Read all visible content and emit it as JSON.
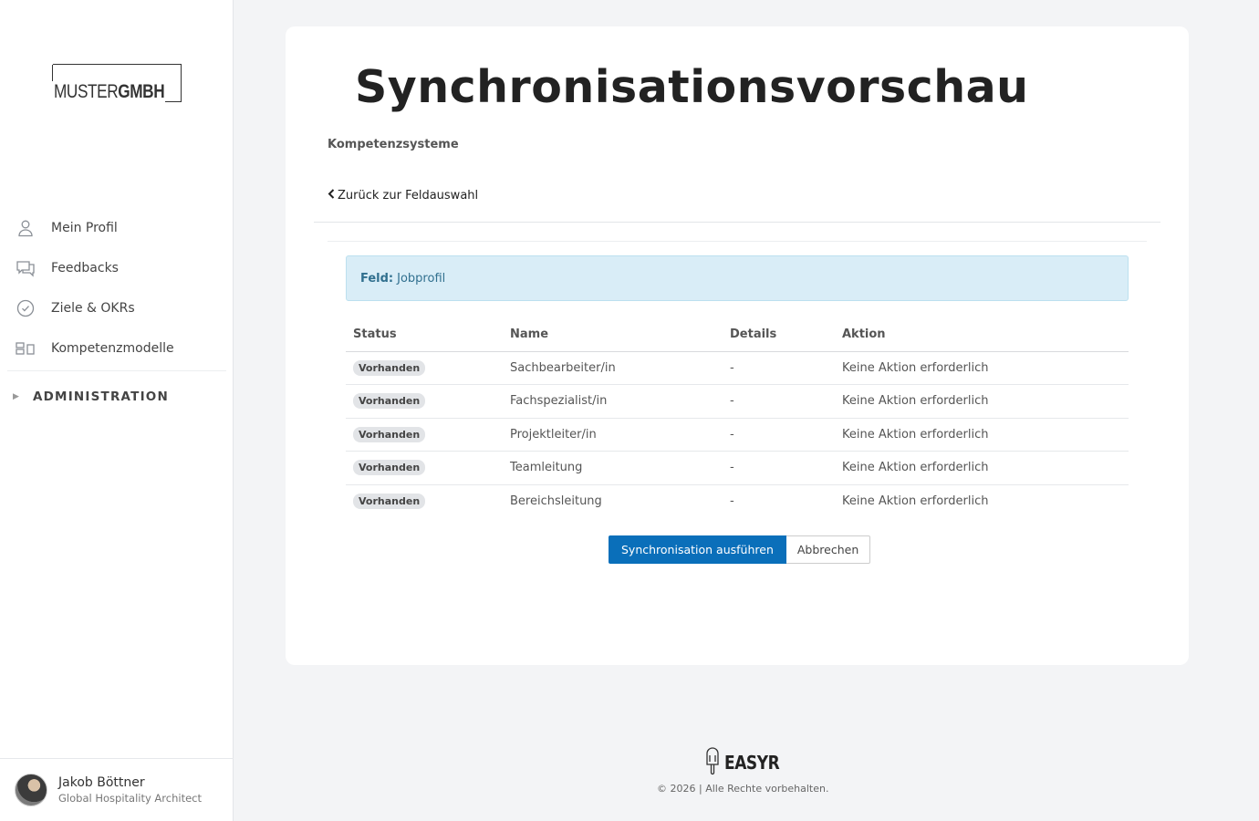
{
  "brand": {
    "logo_light": "MUSTER",
    "logo_bold": "GMBH"
  },
  "nav": {
    "items": [
      {
        "label": "Mein Profil",
        "icon": "user-icon"
      },
      {
        "label": "Feedbacks",
        "icon": "chat-bubbles-icon"
      },
      {
        "label": "Ziele & OKRs",
        "icon": "check-circle-icon"
      },
      {
        "label": "Kompetenzmodelle",
        "icon": "blocks-icon"
      }
    ],
    "admin_label": "ADMINISTRATION"
  },
  "user": {
    "name": "Jakob Böttner",
    "role": "Global Hospitality Architect"
  },
  "page": {
    "title": "Synchronisationsvorschau",
    "subtitle": "Kompetenzsysteme",
    "back_label": "Zurück zur Feldauswahl"
  },
  "alert": {
    "key": "Feld:",
    "value": "Jobprofil"
  },
  "table": {
    "headers": [
      "Status",
      "Name",
      "Details",
      "Aktion"
    ],
    "rows": [
      {
        "status": "Vorhanden",
        "name": "Sachbearbeiter/in",
        "details": "-",
        "action": "Keine Aktion erforderlich"
      },
      {
        "status": "Vorhanden",
        "name": "Fachspezialist/in",
        "details": "-",
        "action": "Keine Aktion erforderlich"
      },
      {
        "status": "Vorhanden",
        "name": "Projektleiter/in",
        "details": "-",
        "action": "Keine Aktion erforderlich"
      },
      {
        "status": "Vorhanden",
        "name": "Teamleitung",
        "details": "-",
        "action": "Keine Aktion erforderlich"
      },
      {
        "status": "Vorhanden",
        "name": "Bereichsleitung",
        "details": "-",
        "action": "Keine Aktion erforderlich"
      }
    ]
  },
  "buttons": {
    "primary": "Synchronisation ausführen",
    "cancel": "Abbrechen"
  },
  "footer": {
    "brand": "EASYR",
    "copyright": "© 2026 | Alle Rechte vorbehalten."
  },
  "colors": {
    "primary": "#0a6fba",
    "alert_bg": "#d9edf7",
    "alert_text": "#31708f",
    "page_bg": "#f3f4f6"
  }
}
